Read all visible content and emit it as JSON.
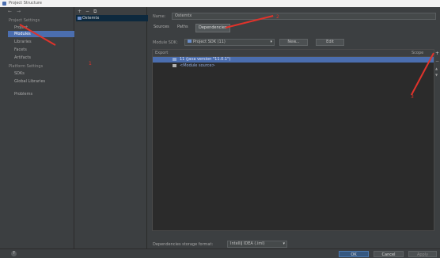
{
  "window": {
    "title": "Project Structure"
  },
  "nav": {
    "back": "←",
    "forward": "→"
  },
  "left": {
    "project_settings": "Project Settings",
    "items_project": [
      "Project",
      "Modules",
      "Libraries",
      "Facets",
      "Artifacts"
    ],
    "platform_settings": "Platform Settings",
    "items_platform": [
      "SDKs",
      "Global Libraries"
    ],
    "problems": "Problems",
    "selected_index": 1
  },
  "middle": {
    "add": "+",
    "remove": "−",
    "copy": "⧉",
    "module": "Ostemtx"
  },
  "right": {
    "name_label": "Name:",
    "name_value": "Ostemtx",
    "tabs": [
      "Sources",
      "Paths",
      "Dependencies"
    ],
    "active_tab": 2,
    "sdk_label": "Module SDK:",
    "sdk_value": "Project SDK (11)",
    "new_btn": "New...",
    "edit_btn": "Edit",
    "col_export": "Export",
    "col_scope": "Scope",
    "rows": [
      {
        "label": "11 (java version \"11.0.1\")",
        "selected": true
      },
      {
        "label": "<Module source>",
        "selected": false
      }
    ],
    "side_buttons": {
      "add": "+",
      "remove": "−",
      "up": "▲",
      "down": "▼"
    },
    "storage_label": "Dependencies storage format:",
    "storage_value": "IntelliJ IDEA (.iml)"
  },
  "footer": {
    "help": "?",
    "ok": "OK",
    "cancel": "Cancel",
    "apply": "Apply"
  },
  "annotations": {
    "n1": "1",
    "n2": "2",
    "n3": "3"
  }
}
